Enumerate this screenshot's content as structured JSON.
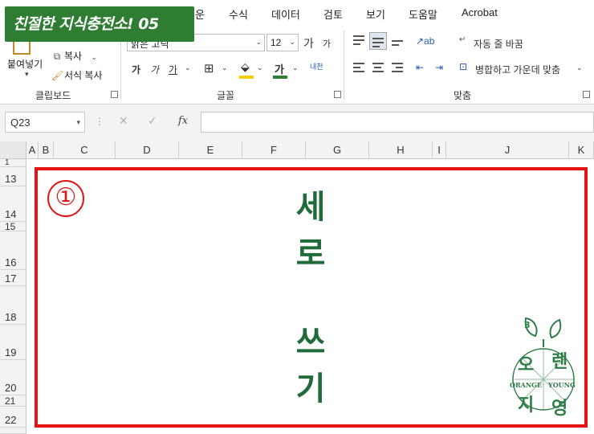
{
  "badge": {
    "text": "친절한 지식충전소! 05"
  },
  "tabs": [
    "운",
    "수식",
    "데이터",
    "검토",
    "보기",
    "도움말",
    "Acrobat"
  ],
  "clipboard": {
    "paste_label": "붙여넣기",
    "copy_label": "복사",
    "format_painter_label": "서식 복사",
    "group_label": "클립보드"
  },
  "font": {
    "font_name": "맑은 고딕",
    "font_size": "12",
    "grow_label": "가",
    "shrink_label": "가",
    "bold_label": "가",
    "italic_label": "가",
    "underline_label": "가",
    "phonetic_label": "내천",
    "group_label": "글꼴",
    "fill_color": "#f0d000",
    "text_color": "#2e7d32"
  },
  "alignment": {
    "wrap_text_label": "자동 줄 바꿈",
    "merge_center_label": "병합하고 가운데 맞춤",
    "group_label": "맞춤"
  },
  "formula_bar": {
    "name_box": "Q23",
    "fx_label": "fx",
    "formula": ""
  },
  "columns": [
    "A",
    "B",
    "C",
    "D",
    "E",
    "F",
    "G",
    "H",
    "I",
    "J",
    "K"
  ],
  "rows": [
    "1",
    "13",
    "14",
    "15",
    "16",
    "17",
    "18",
    "19",
    "20",
    "21",
    "22"
  ],
  "content": {
    "circle_number": "①",
    "vertical_chars": [
      "세",
      "로",
      "쓰",
      "기"
    ],
    "frame_color": "#e21414",
    "text_color": "#1f6b3a"
  },
  "logo": {
    "number": "3",
    "chars": [
      "오",
      "렌",
      "지",
      "영"
    ],
    "left_word": "ORANGE",
    "right_word": "YOUNG"
  }
}
